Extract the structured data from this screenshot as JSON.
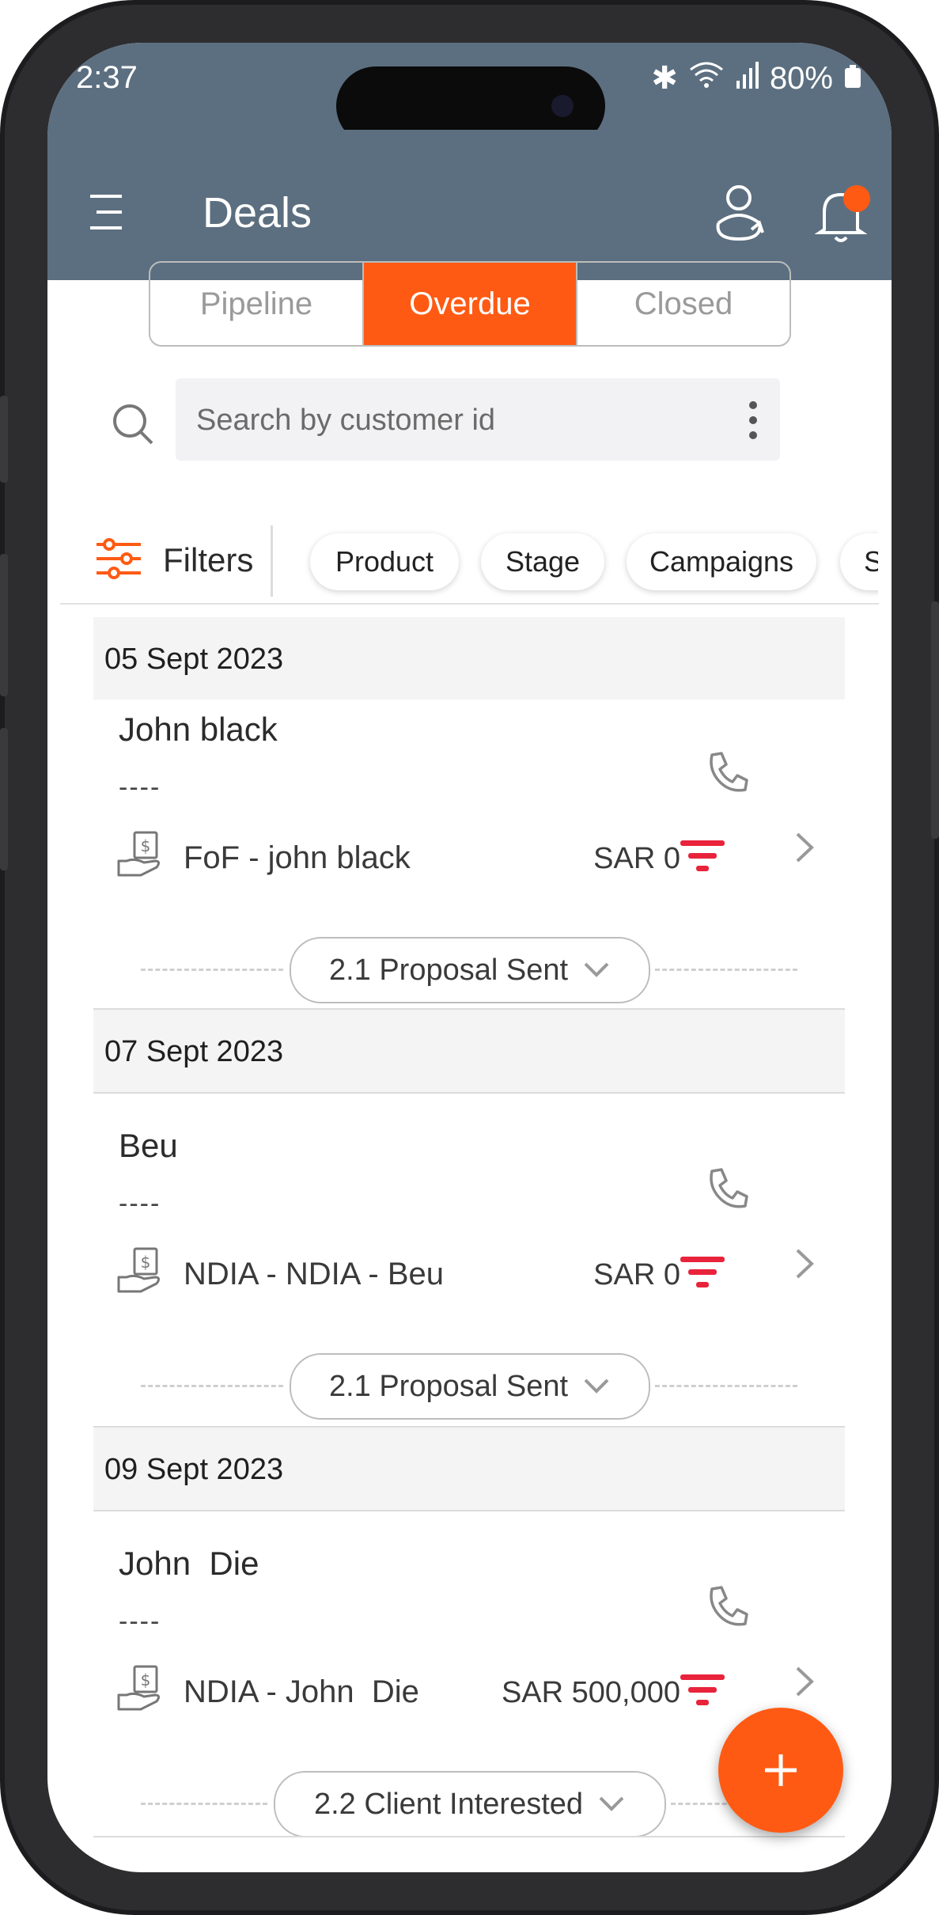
{
  "status_bar": {
    "time": "2:37",
    "battery": "80%"
  },
  "app_bar": {
    "title": "Deals"
  },
  "tabs": [
    {
      "label": "Pipeline",
      "active": false
    },
    {
      "label": "Overdue",
      "active": true
    },
    {
      "label": "Closed",
      "active": false
    }
  ],
  "search": {
    "placeholder": "Search by customer id"
  },
  "filters": {
    "label": "Filters",
    "chips": [
      "Product",
      "Stage",
      "Campaigns",
      "S"
    ]
  },
  "deals": [
    {
      "date": "05 Sept 2023",
      "name": "John black",
      "subtitle": "----",
      "deal_name": "FoF - john black",
      "amount": "SAR 0",
      "stage": "2.1 Proposal Sent"
    },
    {
      "date": "07 Sept 2023",
      "name": "Beu",
      "subtitle": "----",
      "deal_name": "NDIA - NDIA - Beu",
      "amount": "SAR 0",
      "stage": "2.1 Proposal Sent"
    },
    {
      "date": "09 Sept 2023",
      "name": "John  Die",
      "subtitle": "----",
      "deal_name": "NDIA - John  Die",
      "amount": "SAR 500,000",
      "stage": "2.2 Client Interested"
    }
  ],
  "colors": {
    "accent": "#ff5a13",
    "header": "#5c6f80",
    "priority": "#e8233b"
  },
  "icons": [
    "menu-icon",
    "user-sync-icon",
    "bell-icon",
    "search-icon",
    "more-vertical-icon",
    "filters-icon",
    "phone-icon",
    "chevron-right-icon",
    "money-hand-icon",
    "priority-icon",
    "chevron-down-icon",
    "plus-icon"
  ]
}
